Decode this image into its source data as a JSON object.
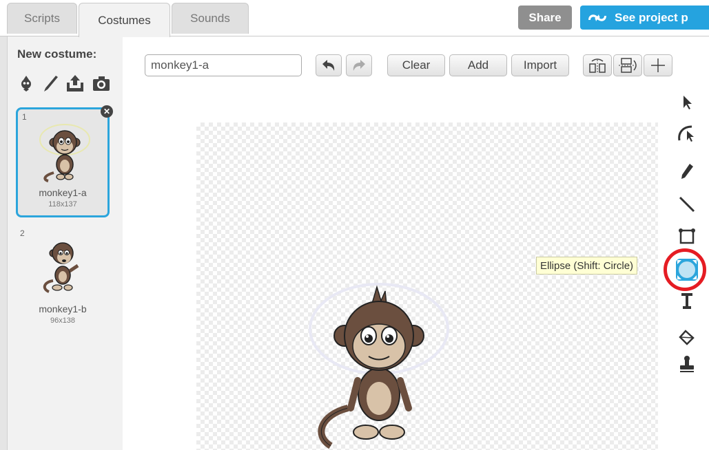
{
  "tabs": [
    {
      "label": "Scripts"
    },
    {
      "label": "Costumes"
    },
    {
      "label": "Sounds"
    }
  ],
  "header": {
    "share_label": "Share",
    "see_project_label": "See project p"
  },
  "sidebar": {
    "new_costume_label": "New costume:",
    "new_costume_icons": [
      "sprite-library-icon",
      "paint-brush-icon",
      "upload-icon",
      "camera-icon"
    ],
    "costumes": [
      {
        "number": "1",
        "name": "monkey1-a",
        "size": "118x137",
        "selected": true
      },
      {
        "number": "2",
        "name": "monkey1-b",
        "size": "96x138",
        "selected": false
      }
    ]
  },
  "editor": {
    "costume_name_value": "monkey1-a",
    "clear_label": "Clear",
    "add_label": "Add",
    "import_label": "Import",
    "tooltip": "Ellipse (Shift: Circle)",
    "tools": [
      "select-icon",
      "reshape-icon",
      "pencil-icon",
      "line-icon",
      "rectangle-icon",
      "ellipse-icon",
      "text-icon",
      "fill-icon",
      "stamp-icon"
    ]
  },
  "colors": {
    "accent_blue": "#25a3df",
    "selection_border": "#2ba5dc",
    "highlight_ring": "#e51c23",
    "share_gray": "#8f8f8f"
  }
}
